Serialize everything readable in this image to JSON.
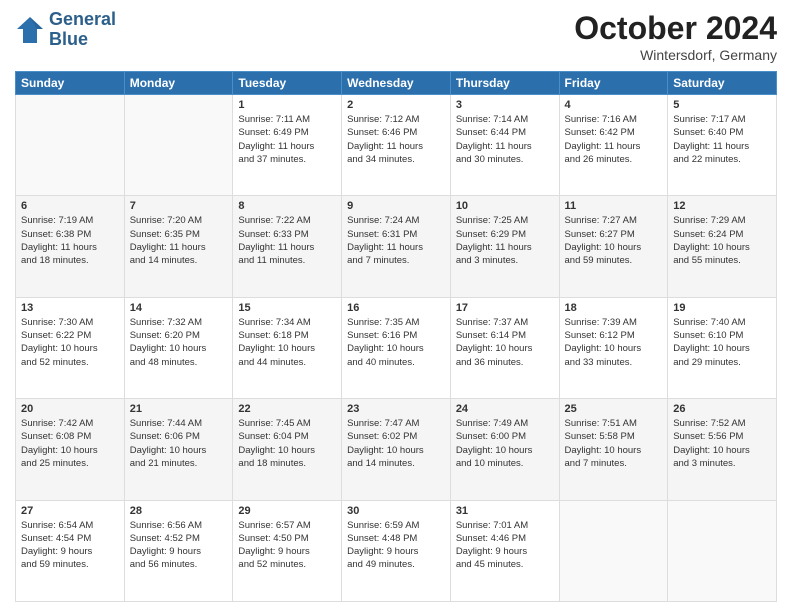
{
  "logo": {
    "line1": "General",
    "line2": "Blue"
  },
  "title": "October 2024",
  "location": "Wintersdorf, Germany",
  "days_header": [
    "Sunday",
    "Monday",
    "Tuesday",
    "Wednesday",
    "Thursday",
    "Friday",
    "Saturday"
  ],
  "weeks": [
    [
      {
        "day": "",
        "info": ""
      },
      {
        "day": "",
        "info": ""
      },
      {
        "day": "1",
        "info": "Sunrise: 7:11 AM\nSunset: 6:49 PM\nDaylight: 11 hours\nand 37 minutes."
      },
      {
        "day": "2",
        "info": "Sunrise: 7:12 AM\nSunset: 6:46 PM\nDaylight: 11 hours\nand 34 minutes."
      },
      {
        "day": "3",
        "info": "Sunrise: 7:14 AM\nSunset: 6:44 PM\nDaylight: 11 hours\nand 30 minutes."
      },
      {
        "day": "4",
        "info": "Sunrise: 7:16 AM\nSunset: 6:42 PM\nDaylight: 11 hours\nand 26 minutes."
      },
      {
        "day": "5",
        "info": "Sunrise: 7:17 AM\nSunset: 6:40 PM\nDaylight: 11 hours\nand 22 minutes."
      }
    ],
    [
      {
        "day": "6",
        "info": "Sunrise: 7:19 AM\nSunset: 6:38 PM\nDaylight: 11 hours\nand 18 minutes."
      },
      {
        "day": "7",
        "info": "Sunrise: 7:20 AM\nSunset: 6:35 PM\nDaylight: 11 hours\nand 14 minutes."
      },
      {
        "day": "8",
        "info": "Sunrise: 7:22 AM\nSunset: 6:33 PM\nDaylight: 11 hours\nand 11 minutes."
      },
      {
        "day": "9",
        "info": "Sunrise: 7:24 AM\nSunset: 6:31 PM\nDaylight: 11 hours\nand 7 minutes."
      },
      {
        "day": "10",
        "info": "Sunrise: 7:25 AM\nSunset: 6:29 PM\nDaylight: 11 hours\nand 3 minutes."
      },
      {
        "day": "11",
        "info": "Sunrise: 7:27 AM\nSunset: 6:27 PM\nDaylight: 10 hours\nand 59 minutes."
      },
      {
        "day": "12",
        "info": "Sunrise: 7:29 AM\nSunset: 6:24 PM\nDaylight: 10 hours\nand 55 minutes."
      }
    ],
    [
      {
        "day": "13",
        "info": "Sunrise: 7:30 AM\nSunset: 6:22 PM\nDaylight: 10 hours\nand 52 minutes."
      },
      {
        "day": "14",
        "info": "Sunrise: 7:32 AM\nSunset: 6:20 PM\nDaylight: 10 hours\nand 48 minutes."
      },
      {
        "day": "15",
        "info": "Sunrise: 7:34 AM\nSunset: 6:18 PM\nDaylight: 10 hours\nand 44 minutes."
      },
      {
        "day": "16",
        "info": "Sunrise: 7:35 AM\nSunset: 6:16 PM\nDaylight: 10 hours\nand 40 minutes."
      },
      {
        "day": "17",
        "info": "Sunrise: 7:37 AM\nSunset: 6:14 PM\nDaylight: 10 hours\nand 36 minutes."
      },
      {
        "day": "18",
        "info": "Sunrise: 7:39 AM\nSunset: 6:12 PM\nDaylight: 10 hours\nand 33 minutes."
      },
      {
        "day": "19",
        "info": "Sunrise: 7:40 AM\nSunset: 6:10 PM\nDaylight: 10 hours\nand 29 minutes."
      }
    ],
    [
      {
        "day": "20",
        "info": "Sunrise: 7:42 AM\nSunset: 6:08 PM\nDaylight: 10 hours\nand 25 minutes."
      },
      {
        "day": "21",
        "info": "Sunrise: 7:44 AM\nSunset: 6:06 PM\nDaylight: 10 hours\nand 21 minutes."
      },
      {
        "day": "22",
        "info": "Sunrise: 7:45 AM\nSunset: 6:04 PM\nDaylight: 10 hours\nand 18 minutes."
      },
      {
        "day": "23",
        "info": "Sunrise: 7:47 AM\nSunset: 6:02 PM\nDaylight: 10 hours\nand 14 minutes."
      },
      {
        "day": "24",
        "info": "Sunrise: 7:49 AM\nSunset: 6:00 PM\nDaylight: 10 hours\nand 10 minutes."
      },
      {
        "day": "25",
        "info": "Sunrise: 7:51 AM\nSunset: 5:58 PM\nDaylight: 10 hours\nand 7 minutes."
      },
      {
        "day": "26",
        "info": "Sunrise: 7:52 AM\nSunset: 5:56 PM\nDaylight: 10 hours\nand 3 minutes."
      }
    ],
    [
      {
        "day": "27",
        "info": "Sunrise: 6:54 AM\nSunset: 4:54 PM\nDaylight: 9 hours\nand 59 minutes."
      },
      {
        "day": "28",
        "info": "Sunrise: 6:56 AM\nSunset: 4:52 PM\nDaylight: 9 hours\nand 56 minutes."
      },
      {
        "day": "29",
        "info": "Sunrise: 6:57 AM\nSunset: 4:50 PM\nDaylight: 9 hours\nand 52 minutes."
      },
      {
        "day": "30",
        "info": "Sunrise: 6:59 AM\nSunset: 4:48 PM\nDaylight: 9 hours\nand 49 minutes."
      },
      {
        "day": "31",
        "info": "Sunrise: 7:01 AM\nSunset: 4:46 PM\nDaylight: 9 hours\nand 45 minutes."
      },
      {
        "day": "",
        "info": ""
      },
      {
        "day": "",
        "info": ""
      }
    ]
  ]
}
